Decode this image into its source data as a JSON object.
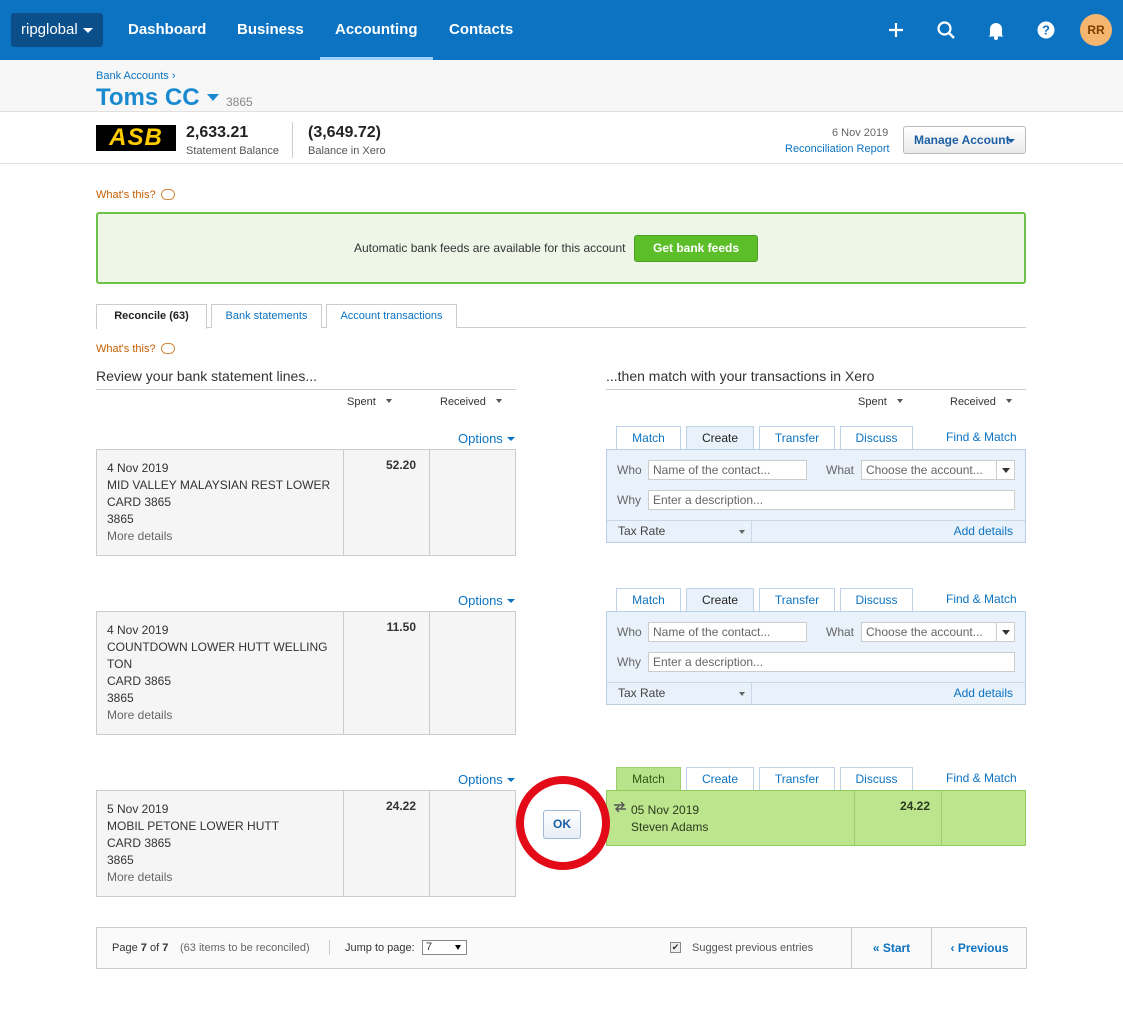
{
  "nav": {
    "org": "ripglobal",
    "links": [
      "Dashboard",
      "Business",
      "Accounting",
      "Contacts"
    ],
    "active": "Accounting",
    "avatar": "RR",
    "icons": [
      "plus-icon",
      "search-icon",
      "bell-icon",
      "help-icon"
    ]
  },
  "header": {
    "breadcrumb": "Bank Accounts ›",
    "title": "Toms CC",
    "account_number": "3865"
  },
  "balances": {
    "bank_logo": "ASB",
    "statement_balance": "2,633.21",
    "statement_label": "Statement Balance",
    "xero_balance": "(3,649.72)",
    "xero_label": "Balance in Xero",
    "date": "6 Nov 2019",
    "reconciliation_report": "Reconciliation Report",
    "manage_account": "Manage Account"
  },
  "whats_this": "What's this?",
  "feeds": {
    "text": "Automatic bank feeds are available for this account",
    "button": "Get bank feeds"
  },
  "tabs": [
    "Reconcile (63)",
    "Bank statements",
    "Account transactions"
  ],
  "left_heading": "Review your bank statement lines...",
  "right_heading": "...then match with your transactions in Xero",
  "col_headers": {
    "spent": "Spent",
    "received": "Received"
  },
  "options_label": "Options",
  "row_tabs": [
    "Match",
    "Create",
    "Transfer",
    "Discuss"
  ],
  "find_match": "Find & Match",
  "create_form": {
    "who_label": "Who",
    "who_placeholder": "Name of the contact...",
    "what_label": "What",
    "what_placeholder": "Choose the account...",
    "why_label": "Why",
    "why_placeholder": "Enter a description...",
    "tax_rate": "Tax Rate",
    "add_details": "Add details"
  },
  "statement_lines": [
    {
      "date": "4 Nov 2019",
      "line1": "MID VALLEY MALAYSIAN REST LOWER",
      "line2": "CARD 3865",
      "line3": "3865",
      "more": "More details",
      "spent": "52.20",
      "active_tab": "Create"
    },
    {
      "date": "4 Nov 2019",
      "line1": "COUNTDOWN LOWER HUTT WELLING",
      "line1b": "TON",
      "line2": "CARD 3865",
      "line3": "3865",
      "more": "More details",
      "spent": "11.50",
      "active_tab": "Create"
    },
    {
      "date": "5 Nov 2019",
      "line1": "MOBIL PETONE LOWER HUTT",
      "line2": "CARD 3865",
      "line3": "3865",
      "more": "More details",
      "spent": "24.22",
      "active_tab": "Match"
    }
  ],
  "match_suggestion": {
    "date": "05 Nov 2019",
    "contact": "Steven Adams",
    "spent": "24.22"
  },
  "ok_button": "OK",
  "pager": {
    "page_prefix": "Page",
    "page": "7",
    "of": "of",
    "total_pages": "7",
    "items_note": "(63 items to be reconciled)",
    "jump_label": "Jump to page:",
    "jump_value": "7",
    "suggest_label": "Suggest previous entries",
    "suggest_checked": true,
    "start": "« Start",
    "previous": "‹ Previous"
  }
}
